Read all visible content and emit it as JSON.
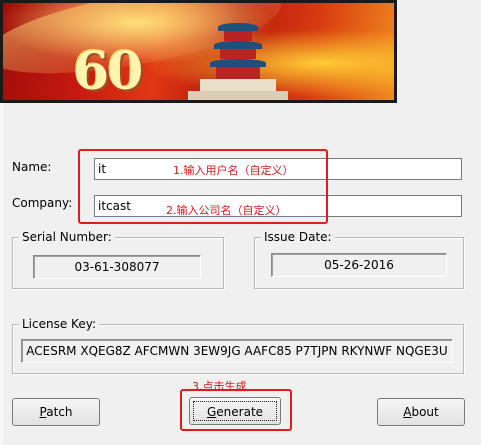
{
  "banner": {
    "number": "60"
  },
  "form": {
    "name_label": "Name:",
    "name_value": "it",
    "name_note": "1.输入用户名（自定义）",
    "company_label": "Company:",
    "company_value": "itcast",
    "company_note": "2.输入公司名（自定义）"
  },
  "serial": {
    "label": "Serial Number:",
    "value": "03-61-308077"
  },
  "issue": {
    "label": "Issue Date:",
    "value": "05-26-2016"
  },
  "license": {
    "label": "License Key:",
    "value": "ACESRM XQEG8Z AFCMWN 3EW9JG AAFC85 P7TJPN RKYNWF NQGE3U"
  },
  "step3_note": "3.点击生成",
  "buttons": {
    "patch_first": "P",
    "patch_rest": "atch",
    "generate_first": "G",
    "generate_rest": "enerate",
    "about_first": "A",
    "about_rest": "bout"
  },
  "colors": {
    "annotation": "#e21b1b",
    "window_bg": "#f0f0f0"
  }
}
